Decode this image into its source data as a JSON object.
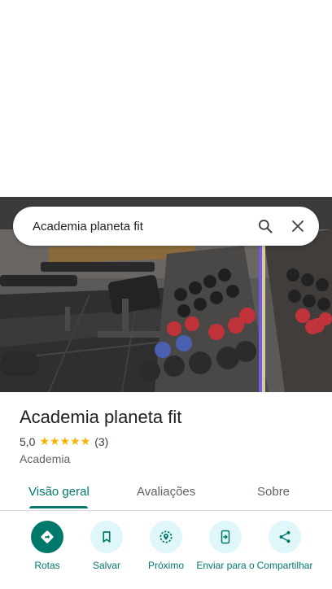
{
  "search": {
    "query": "Academia planeta fit"
  },
  "place": {
    "name": "Academia planeta fit",
    "rating": "5,0",
    "stars": "★★★★★",
    "review_count": "(3)",
    "category": "Academia"
  },
  "tabs": [
    {
      "label": "Visão geral",
      "active": true
    },
    {
      "label": "Avaliações",
      "active": false
    },
    {
      "label": "Sobre",
      "active": false
    }
  ],
  "actions": [
    {
      "label": "Rotas",
      "icon": "directions-icon"
    },
    {
      "label": "Salvar",
      "icon": "bookmark-icon"
    },
    {
      "label": "Próximo",
      "icon": "nearby-icon"
    },
    {
      "label": "Enviar para o",
      "icon": "send-to-phone-icon"
    },
    {
      "label": "Compartilhar",
      "icon": "share-icon"
    }
  ],
  "colors": {
    "accent": "#00796b",
    "action_bg": "#e0f7fa",
    "star": "#f5b400"
  }
}
